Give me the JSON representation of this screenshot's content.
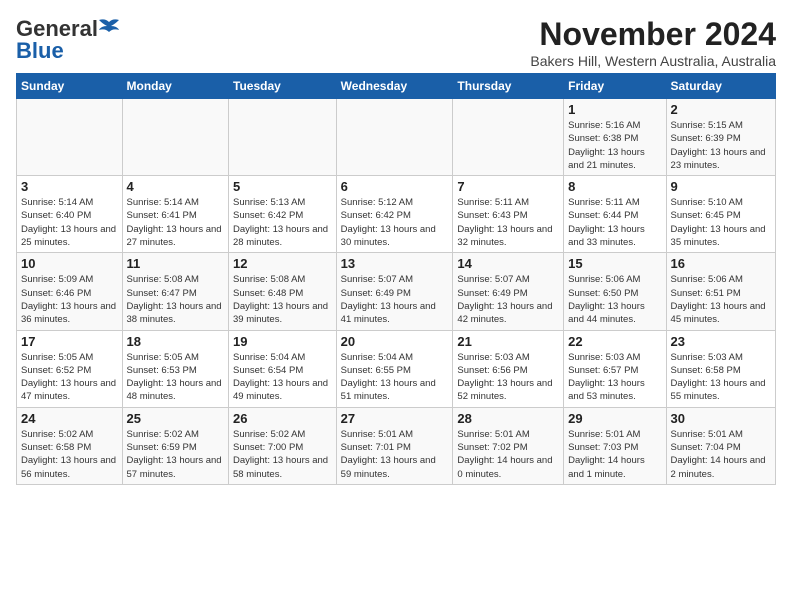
{
  "logo": {
    "text_general": "General",
    "text_blue": "Blue"
  },
  "title": "November 2024",
  "subtitle": "Bakers Hill, Western Australia, Australia",
  "days_of_week": [
    "Sunday",
    "Monday",
    "Tuesday",
    "Wednesday",
    "Thursday",
    "Friday",
    "Saturday"
  ],
  "weeks": [
    [
      {
        "day": "",
        "info": ""
      },
      {
        "day": "",
        "info": ""
      },
      {
        "day": "",
        "info": ""
      },
      {
        "day": "",
        "info": ""
      },
      {
        "day": "",
        "info": ""
      },
      {
        "day": "1",
        "info": "Sunrise: 5:16 AM\nSunset: 6:38 PM\nDaylight: 13 hours and 21 minutes."
      },
      {
        "day": "2",
        "info": "Sunrise: 5:15 AM\nSunset: 6:39 PM\nDaylight: 13 hours and 23 minutes."
      }
    ],
    [
      {
        "day": "3",
        "info": "Sunrise: 5:14 AM\nSunset: 6:40 PM\nDaylight: 13 hours and 25 minutes."
      },
      {
        "day": "4",
        "info": "Sunrise: 5:14 AM\nSunset: 6:41 PM\nDaylight: 13 hours and 27 minutes."
      },
      {
        "day": "5",
        "info": "Sunrise: 5:13 AM\nSunset: 6:42 PM\nDaylight: 13 hours and 28 minutes."
      },
      {
        "day": "6",
        "info": "Sunrise: 5:12 AM\nSunset: 6:42 PM\nDaylight: 13 hours and 30 minutes."
      },
      {
        "day": "7",
        "info": "Sunrise: 5:11 AM\nSunset: 6:43 PM\nDaylight: 13 hours and 32 minutes."
      },
      {
        "day": "8",
        "info": "Sunrise: 5:11 AM\nSunset: 6:44 PM\nDaylight: 13 hours and 33 minutes."
      },
      {
        "day": "9",
        "info": "Sunrise: 5:10 AM\nSunset: 6:45 PM\nDaylight: 13 hours and 35 minutes."
      }
    ],
    [
      {
        "day": "10",
        "info": "Sunrise: 5:09 AM\nSunset: 6:46 PM\nDaylight: 13 hours and 36 minutes."
      },
      {
        "day": "11",
        "info": "Sunrise: 5:08 AM\nSunset: 6:47 PM\nDaylight: 13 hours and 38 minutes."
      },
      {
        "day": "12",
        "info": "Sunrise: 5:08 AM\nSunset: 6:48 PM\nDaylight: 13 hours and 39 minutes."
      },
      {
        "day": "13",
        "info": "Sunrise: 5:07 AM\nSunset: 6:49 PM\nDaylight: 13 hours and 41 minutes."
      },
      {
        "day": "14",
        "info": "Sunrise: 5:07 AM\nSunset: 6:49 PM\nDaylight: 13 hours and 42 minutes."
      },
      {
        "day": "15",
        "info": "Sunrise: 5:06 AM\nSunset: 6:50 PM\nDaylight: 13 hours and 44 minutes."
      },
      {
        "day": "16",
        "info": "Sunrise: 5:06 AM\nSunset: 6:51 PM\nDaylight: 13 hours and 45 minutes."
      }
    ],
    [
      {
        "day": "17",
        "info": "Sunrise: 5:05 AM\nSunset: 6:52 PM\nDaylight: 13 hours and 47 minutes."
      },
      {
        "day": "18",
        "info": "Sunrise: 5:05 AM\nSunset: 6:53 PM\nDaylight: 13 hours and 48 minutes."
      },
      {
        "day": "19",
        "info": "Sunrise: 5:04 AM\nSunset: 6:54 PM\nDaylight: 13 hours and 49 minutes."
      },
      {
        "day": "20",
        "info": "Sunrise: 5:04 AM\nSunset: 6:55 PM\nDaylight: 13 hours and 51 minutes."
      },
      {
        "day": "21",
        "info": "Sunrise: 5:03 AM\nSunset: 6:56 PM\nDaylight: 13 hours and 52 minutes."
      },
      {
        "day": "22",
        "info": "Sunrise: 5:03 AM\nSunset: 6:57 PM\nDaylight: 13 hours and 53 minutes."
      },
      {
        "day": "23",
        "info": "Sunrise: 5:03 AM\nSunset: 6:58 PM\nDaylight: 13 hours and 55 minutes."
      }
    ],
    [
      {
        "day": "24",
        "info": "Sunrise: 5:02 AM\nSunset: 6:58 PM\nDaylight: 13 hours and 56 minutes."
      },
      {
        "day": "25",
        "info": "Sunrise: 5:02 AM\nSunset: 6:59 PM\nDaylight: 13 hours and 57 minutes."
      },
      {
        "day": "26",
        "info": "Sunrise: 5:02 AM\nSunset: 7:00 PM\nDaylight: 13 hours and 58 minutes."
      },
      {
        "day": "27",
        "info": "Sunrise: 5:01 AM\nSunset: 7:01 PM\nDaylight: 13 hours and 59 minutes."
      },
      {
        "day": "28",
        "info": "Sunrise: 5:01 AM\nSunset: 7:02 PM\nDaylight: 14 hours and 0 minutes."
      },
      {
        "day": "29",
        "info": "Sunrise: 5:01 AM\nSunset: 7:03 PM\nDaylight: 14 hours and 1 minute."
      },
      {
        "day": "30",
        "info": "Sunrise: 5:01 AM\nSunset: 7:04 PM\nDaylight: 14 hours and 2 minutes."
      }
    ]
  ]
}
